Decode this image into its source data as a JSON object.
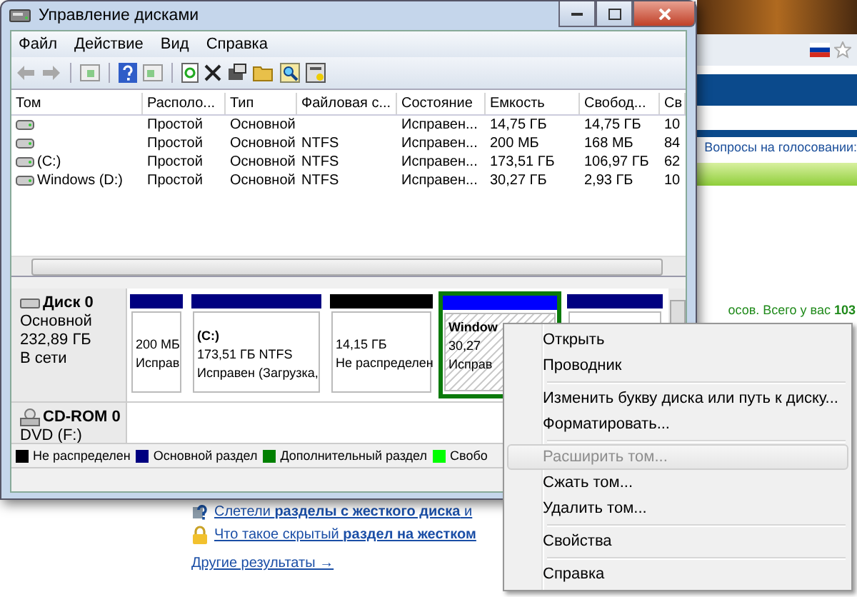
{
  "browser": {
    "poll_link": "Вопросы на голосовании:",
    "stats_text": "осов. Всего у вас **103**",
    "links": [
      {
        "text": "Слетели **разделы с жесткого диска** и",
        "kind": "question"
      },
      {
        "text": "Что такое скрытый **раздел на жестком**",
        "kind": "lock"
      }
    ],
    "more_link": "Другие результаты →"
  },
  "window": {
    "title": "Управление дисками",
    "menu": [
      "Файл",
      "Действие",
      "Вид",
      "Справка"
    ]
  },
  "volumes": {
    "columns": [
      "Том",
      "Располо...",
      "Тип",
      "Файловая с...",
      "Состояние",
      "Емкость",
      "Свобод...",
      "Св"
    ],
    "rows": [
      [
        "",
        "Простой",
        "Основной",
        "",
        "Исправен...",
        "14,75 ГБ",
        "14,75 ГБ",
        "10"
      ],
      [
        "",
        "Простой",
        "Основной",
        "NTFS",
        "Исправен...",
        "200 МБ",
        "168 МБ",
        "84"
      ],
      [
        "(C:)",
        "Простой",
        "Основной",
        "NTFS",
        "Исправен...",
        "173,51 ГБ",
        "106,97 ГБ",
        "62"
      ],
      [
        "Windows (D:)",
        "Простой",
        "Основной",
        "NTFS",
        "Исправен...",
        "30,27 ГБ",
        "2,93 ГБ",
        "10"
      ]
    ]
  },
  "disks": [
    {
      "kind": "hdd",
      "name": "Диск 0",
      "lines": [
        "Основной",
        "232,89 ГБ",
        "В сети"
      ],
      "partitions": [
        {
          "kind": "primary",
          "lines": [
            "200 МБ",
            "Исправ"
          ],
          "selected": false
        },
        {
          "kind": "primary",
          "name": "(C:)",
          "lines": [
            "173,51 ГБ NTFS",
            "Исправен (Загрузка,"
          ],
          "selected": false
        },
        {
          "kind": "unallocated",
          "lines": [
            "14,15 ГБ",
            "Не распределен"
          ],
          "selected": false
        },
        {
          "kind": "logical",
          "name": "Window",
          "lines": [
            "30,27",
            "Исправ"
          ],
          "selected": true
        },
        {
          "kind": "primary",
          "selected": false
        }
      ]
    },
    {
      "kind": "cdrom",
      "name": "CD-ROM 0",
      "lines": [
        "DVD (F:)"
      ]
    }
  ],
  "legend": [
    {
      "label": "Не распределен",
      "color": "#000000"
    },
    {
      "label": "Основной раздел",
      "color": "#000080"
    },
    {
      "label": "Дополнительный раздел",
      "color": "#008000"
    },
    {
      "label": "Свобо",
      "color": "#00ff00"
    }
  ],
  "context_menu": [
    [
      {
        "label": "Открыть",
        "disabled": false,
        "selected": false
      },
      {
        "label": "Проводник",
        "disabled": false,
        "selected": false
      }
    ],
    [
      {
        "label": "Изменить букву диска или путь к диску...",
        "disabled": false,
        "selected": false
      },
      {
        "label": "Форматировать...",
        "disabled": false,
        "selected": false
      }
    ],
    [
      {
        "label": "Расширить том...",
        "disabled": true,
        "selected": true
      },
      {
        "label": "Сжать том...",
        "disabled": false,
        "selected": false
      },
      {
        "label": "Удалить том...",
        "disabled": false,
        "selected": false
      }
    ],
    [
      {
        "label": "Свойства",
        "disabled": false,
        "selected": false
      }
    ],
    [
      {
        "label": "Справка",
        "disabled": false,
        "selected": false
      }
    ]
  ]
}
